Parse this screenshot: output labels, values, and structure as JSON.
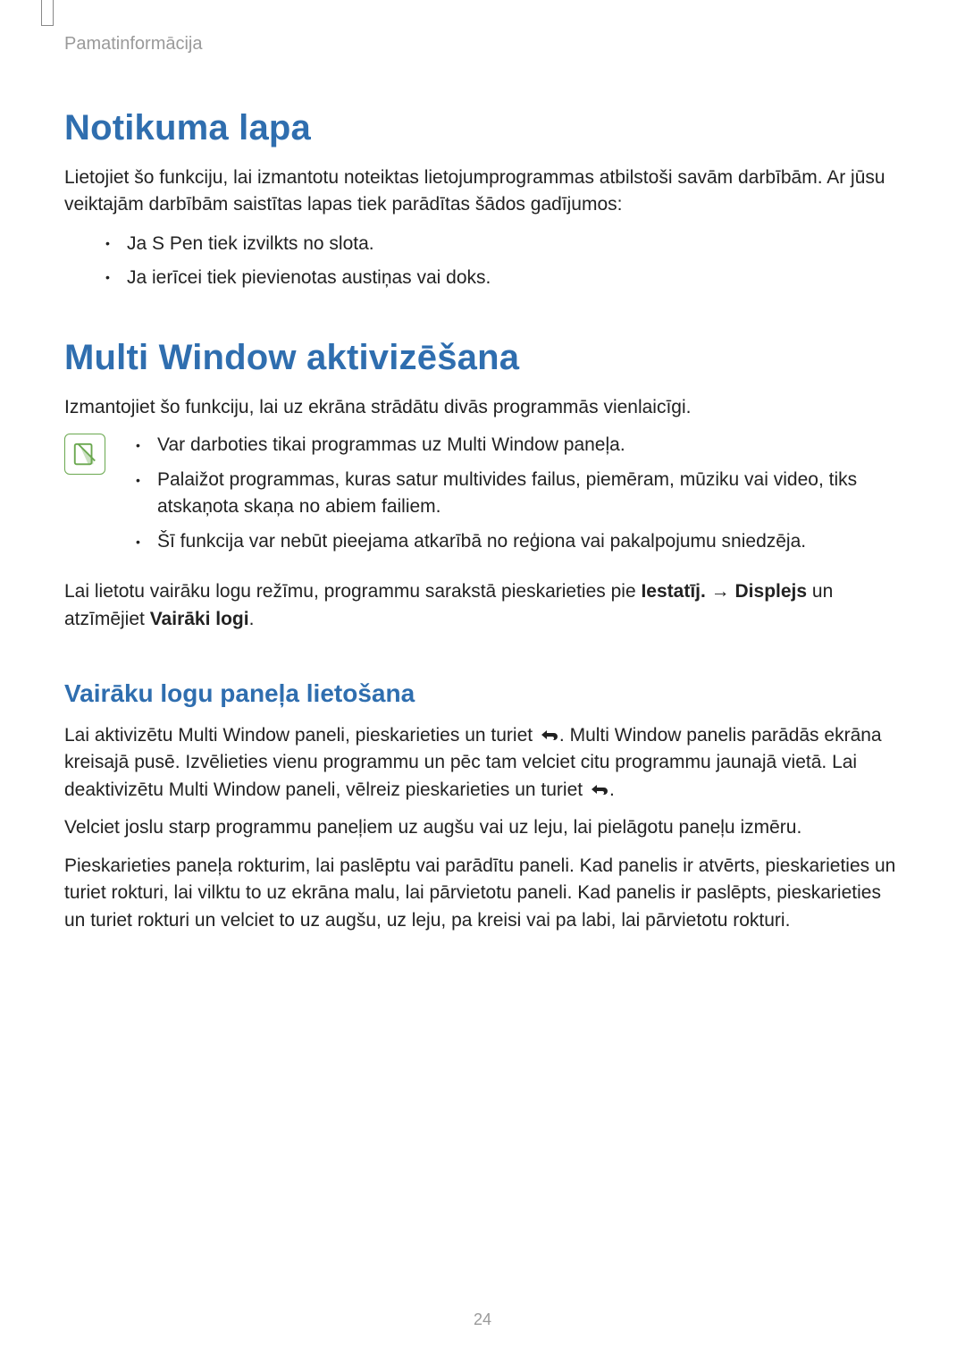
{
  "header": {
    "running": "Pamatinformācija"
  },
  "section1": {
    "title": "Notikuma lapa",
    "intro": "Lietojiet šo funkciju, lai izmantotu noteiktas lietojumprogrammas atbilstoši savām darbībām. Ar jūsu veiktajām darbībām saistītas lapas tiek parādītas šādos gadījumos:",
    "bullets": [
      "Ja S Pen tiek izvilkts no slota.",
      "Ja ierīcei tiek pievienotas austiņas vai doks."
    ]
  },
  "section2": {
    "title": "Multi Window aktivizēšana",
    "intro": "Izmantojiet šo funkciju, lai uz ekrāna strādātu divās programmās vienlaicīgi.",
    "notes": [
      "Var darboties tikai programmas uz Multi Window paneļa.",
      "Palaižot programmas, kuras satur multivides failus, piemēram, mūziku vai video, tiks atskaņota skaņa no abiem failiem.",
      "Šī funkcija var nebūt pieejama atkarībā no reģiona vai pakalpojumu sniedzēja."
    ],
    "enable_pre": "Lai lietotu vairāku logu režīmu, programmu sarakstā pieskarieties pie ",
    "enable_bold1": "Iestatīj.",
    "enable_arrow": " → ",
    "enable_bold2": "Displejs",
    "enable_mid": " un atzīmējiet ",
    "enable_bold3": "Vairāki logi",
    "enable_post": "."
  },
  "section3": {
    "title": "Vairāku logu paneļa lietošana",
    "p1a": "Lai aktivizētu Multi Window paneli, pieskarieties un turiet ",
    "p1b": ". Multi Window panelis parādās ekrāna kreisajā pusē. Izvēlieties vienu programmu un pēc tam velciet citu programmu jaunajā vietā. Lai deaktivizētu Multi Window paneli, vēlreiz pieskarieties un turiet ",
    "p1c": ".",
    "p2": "Velciet joslu starp programmu paneļiem uz augšu vai uz leju, lai pielāgotu paneļu izmēru.",
    "p3": "Pieskarieties paneļa rokturim, lai paslēptu vai parādītu paneli. Kad panelis ir atvērts, pieskarieties un turiet rokturi, lai vilktu to uz ekrāna malu, lai pārvietotu paneli. Kad panelis ir paslēpts, pieskarieties un turiet rokturi un velciet to uz augšu, uz leju, pa kreisi vai pa labi, lai pārvietotu rokturi."
  },
  "page_number": "24"
}
